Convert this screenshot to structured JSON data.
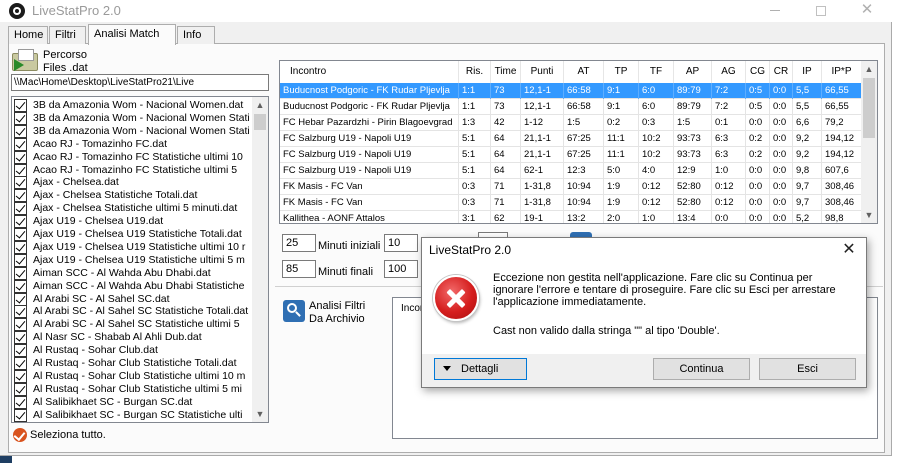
{
  "window": {
    "title": "LiveStatPro 2.0",
    "close_glyph": "✕"
  },
  "tabs": [
    {
      "label": "Home"
    },
    {
      "label": "Filtri"
    },
    {
      "label": "Analisi Match"
    },
    {
      "label": "Info"
    }
  ],
  "left_panel": {
    "percorso_line1": "Percorso",
    "percorso_line2": "Files .dat",
    "path": "\\\\Mac\\Home\\Desktop\\LiveStatPro21\\Live",
    "files": [
      "3B da Amazonia Wom - Nacional Women.dat",
      "3B da Amazonia Wom - Nacional Women  Stati",
      "3B da Amazonia Wom - Nacional Women  Stati",
      "Acao RJ - Tomazinho FC.dat",
      "Acao RJ - Tomazinho FC  Statistiche ultimi 10",
      "Acao RJ - Tomazinho FC  Statistiche ultimi 5",
      "Ajax - Chelsea.dat",
      "Ajax - Chelsea  Statistiche Totali.dat",
      "Ajax - Chelsea  Statistiche ultimi 5 minuti.dat",
      "Ajax U19 - Chelsea U19.dat",
      "Ajax U19 - Chelsea U19  Statistiche Totali.dat",
      "Ajax U19 - Chelsea U19  Statistiche ultimi 10 r",
      "Ajax U19 - Chelsea U19  Statistiche ultimi 5 m",
      "Aiman SCC - Al Wahda Abu Dhabi.dat",
      "Aiman SCC - Al Wahda Abu Dhabi  Statistiche",
      "Al Arabi SC - Al Sahel SC.dat",
      "Al Arabi SC - Al Sahel SC  Statistiche Totali.dat",
      "Al Arabi SC - Al Sahel SC  Statistiche ultimi 5",
      "Al Nasr SC - Shabab Al Ahli Dub.dat",
      "Al Rustaq - Sohar Club.dat",
      "Al Rustaq - Sohar Club  Statistiche Totali.dat",
      "Al Rustaq - Sohar Club  Statistiche ultimi 10 m",
      "Al Rustaq - Sohar Club  Statistiche ultimi 5 mi",
      "Al Salibikhaet SC - Burgan SC.dat",
      "Al Salibikhaet SC - Burgan SC  Statistiche ulti"
    ],
    "select_all": "Seleziona tutto."
  },
  "table": {
    "columns": [
      "Incontro",
      "Ris.",
      "Time",
      "Punti",
      "AT",
      "TP",
      "TF",
      "AP",
      "AG",
      "CG",
      "CR",
      "IP",
      "IP*P"
    ],
    "rows": [
      [
        "Buducnost Podgoric - FK Rudar Pljevlja",
        "1:1",
        "73",
        "12,1-1",
        "66:58",
        "9:1",
        "6:0",
        "89:79",
        "7:2",
        "0:5",
        "0:0",
        "5,5",
        "66,55"
      ],
      [
        "Buducnost Podgoric - FK Rudar Pljevlja",
        "1:1",
        "73",
        "12,1-1",
        "66:58",
        "9:1",
        "6:0",
        "89:79",
        "7:2",
        "0:5",
        "0:0",
        "5,5",
        "66,55"
      ],
      [
        "FC Hebar Pazardzhi - Pirin Blagoevgrad",
        "1:3",
        "42",
        "1-12",
        "1:5",
        "0:2",
        "0:3",
        "1:5",
        "0:1",
        "0:0",
        "0:0",
        "6,6",
        "79,2"
      ],
      [
        "FC Salzburg U19 - Napoli U19",
        "5:1",
        "64",
        "21,1-1",
        "67:25",
        "11:1",
        "10:2",
        "93:73",
        "6:3",
        "0:2",
        "0:0",
        "9,2",
        "194,12"
      ],
      [
        "FC Salzburg U19 - Napoli U19",
        "5:1",
        "64",
        "21,1-1",
        "67:25",
        "11:1",
        "10:2",
        "93:73",
        "6:3",
        "0:2",
        "0:0",
        "9,2",
        "194,12"
      ],
      [
        "FC Salzburg U19 - Napoli U19",
        "5:1",
        "64",
        "62-1",
        "12:3",
        "5:0",
        "4:0",
        "12:9",
        "1:0",
        "0:0",
        "0:0",
        "9,8",
        "607,6"
      ],
      [
        "FK Masis - FC Van",
        "0:3",
        "71",
        "1-31,8",
        "10:94",
        "1:9",
        "0:12",
        "52:80",
        "0:12",
        "0:0",
        "0:0",
        "9,7",
        "308,46"
      ],
      [
        "FK Masis - FC Van",
        "0:3",
        "71",
        "1-31,8",
        "10:94",
        "1:9",
        "0:12",
        "52:80",
        "0:12",
        "0:0",
        "0:0",
        "9,7",
        "308,46"
      ],
      [
        "Kallithea - AONF Attalos",
        "3:1",
        "62",
        "19-1",
        "13:2",
        "2:0",
        "1:0",
        "13:4",
        "0:0",
        "0:0",
        "0:0",
        "5,2",
        "98,8"
      ]
    ],
    "selected_row": 0
  },
  "filters": {
    "minuti_iniziali_value": "25",
    "minuti_iniziali_label": "Minuti iniziali",
    "minuti_finali_value": "85",
    "minuti_finali_label": "Minuti finali",
    "second_value_1": "10",
    "second_value_2": "100",
    "right_label_1": "F",
    "right_label_2": "F"
  },
  "archive": {
    "label_line1": "Analisi Filtri",
    "label_line2": "Da Archivio",
    "result_header": "Incor"
  },
  "dialog": {
    "title": "LiveStatPro 2.0",
    "close_glyph": "✕",
    "message": "Eccezione non gestita nell'applicazione. Fare clic su Continua per ignorare l'errore e tentare di proseguire. Fare clic su Esci per arrestare l'applicazione immediatamente.",
    "detail": "Cast non valido dalla stringa \"\" al tipo 'Double'.",
    "details_button": "Dettagli",
    "continue_button": "Continua",
    "exit_button": "Esci"
  },
  "colors": {
    "selection": "#3399ff",
    "error_red": "#d51e1e",
    "accent_blue": "#2f6fb3"
  }
}
